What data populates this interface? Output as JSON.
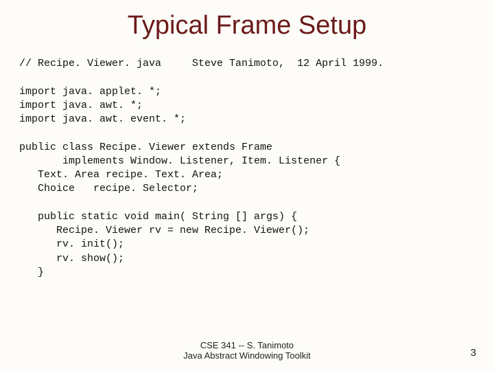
{
  "title": "Typical Frame Setup",
  "code": {
    "l01": "// Recipe. Viewer. java     Steve Tanimoto,  12 April 1999.",
    "l02": "",
    "l03": "import java. applet. *;",
    "l04": "import java. awt. *;",
    "l05": "import java. awt. event. *;",
    "l06": "",
    "l07": "public class Recipe. Viewer extends Frame",
    "l08": "       implements Window. Listener, Item. Listener {",
    "l09": "   Text. Area recipe. Text. Area;",
    "l10": "   Choice   recipe. Selector;",
    "l11": "",
    "l12": "   public static void main( String [] args) {",
    "l13": "      Recipe. Viewer rv = new Recipe. Viewer();",
    "l14": "      rv. init();",
    "l15": "      rv. show();",
    "l16": "   }"
  },
  "footer": {
    "line1": "CSE 341 -- S. Tanimoto",
    "line2": "Java Abstract Windowing Toolkit"
  },
  "pagenum": "3"
}
